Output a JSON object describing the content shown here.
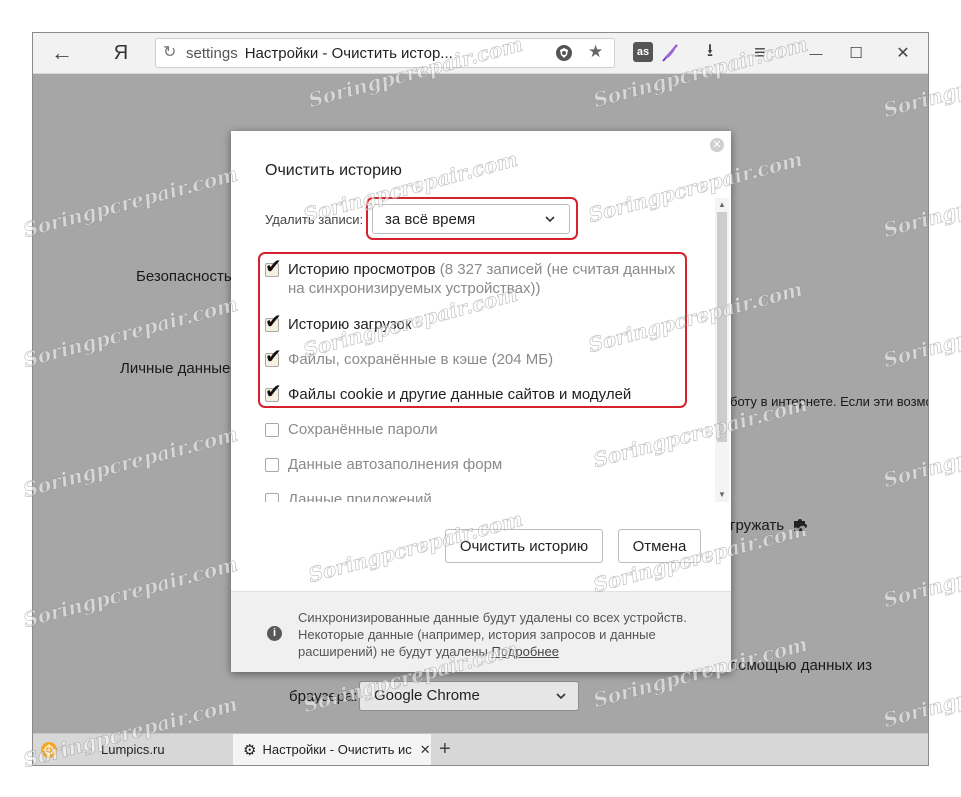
{
  "toolbar": {
    "back_icon": "←",
    "yandex_logo": "Я",
    "reload_icon": "↻",
    "address_host": "settings",
    "address_title": "Настройки - Очистить истор...",
    "protect_icon": "shield-icon",
    "bookmark_icon": "★",
    "lastfm_label": "as",
    "download_icon": "⭳",
    "menu_icon": "≡",
    "minimize_icon": "—",
    "maximize_icon": "☐",
    "close_icon": "✕"
  },
  "background": {
    "security_label": "Безопасность",
    "personal_data_label": "Личные данные",
    "partial_text_1": "боту в интернете. Если эти возмож",
    "partial_text_2": "гружать",
    "partial_text_3": "помощью данных из",
    "browser_label": "браузера:",
    "browser_select_value": "Google Chrome"
  },
  "dialog": {
    "title": "Очистить историю",
    "delete_label": "Удалить записи:",
    "period_value": "за всё время",
    "options": [
      {
        "label": "Историю просмотров",
        "count": "(8 327 записей (не считая данных",
        "count2": "на синхронизируемых устройствах))",
        "checked": true
      },
      {
        "label": "Историю загрузок",
        "checked": true
      },
      {
        "label": "Файлы, сохранённые в кэше",
        "count": "(204 МБ)",
        "checked": true
      },
      {
        "label": "Файлы cookie и другие данные сайтов и модулей",
        "checked": true
      },
      {
        "label": "Сохранённые пароли",
        "checked": false
      },
      {
        "label": "Данные автозаполнения форм",
        "checked": false
      },
      {
        "label": "Данные приложений",
        "checked": false
      }
    ],
    "clear_button": "Очистить историю",
    "cancel_button": "Отмена",
    "info_icon": "i",
    "footer_line1": "Синхронизированные данные будут удалены со всех устройств.",
    "footer_line2": "Некоторые данные (например, история запросов и данные",
    "footer_line3": "расширений) не будут удалены",
    "footer_link": "Подробнее"
  },
  "tabs": [
    {
      "label": "Lumpics.ru"
    },
    {
      "label": "Настройки - Очистить ис"
    }
  ],
  "new_tab_icon": "+",
  "watermark": "Soringpcrepair.com",
  "colors": {
    "highlight": "#d6222c",
    "page_dim": "#a6a6a6"
  }
}
